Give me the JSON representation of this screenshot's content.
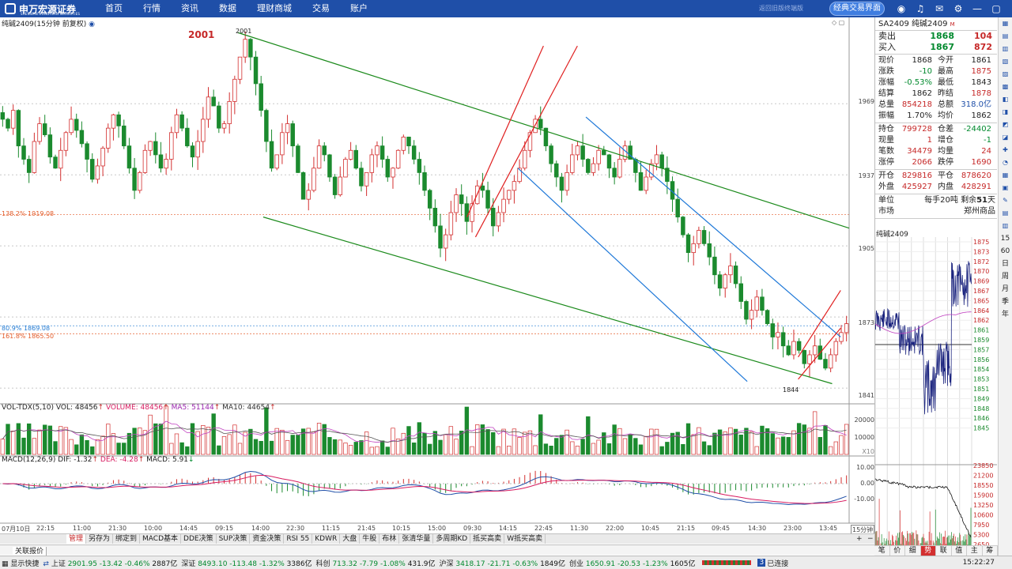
{
  "topbar": {
    "logo": "申万宏源证券",
    "logo_sub": "SHENWAN HONGYUAN SECURITIES",
    "nav": [
      "首页",
      "行情",
      "资讯",
      "数据",
      "理财商城",
      "交易",
      "账户"
    ],
    "hint": "返回旧版终端版",
    "classic_button": "经典交易界面"
  },
  "chart": {
    "title": "纯碱2409(15分钟 前复权)",
    "peak_label": "2001",
    "peak_note": "2001",
    "low_note": "1844",
    "fib": [
      {
        "text": "138.2% 1919.08",
        "color": "#e35d2b",
        "price": 1919.08
      },
      {
        "text": "80.9% 1869.08",
        "color": "#1f78d1",
        "price": 1869.08
      },
      {
        "text": "161.8% 1865.50",
        "color": "#e35d2b",
        "price": 1865.5
      }
    ],
    "price_axis": [
      "1969",
      "1937",
      "1905",
      "1873",
      "1841"
    ],
    "x_labels": [
      "07月10日",
      "22:15",
      "11:00",
      "21:30",
      "10:00",
      "14:45",
      "09:15",
      "14:00",
      "22:30",
      "11:15",
      "21:45",
      "10:15",
      "15:00",
      "09:30",
      "14:15",
      "22:45",
      "11:30",
      "22:00",
      "10:45",
      "21:15",
      "09:45",
      "14:30",
      "23:00",
      "13:45"
    ],
    "period": "15分钟",
    "vol_title": {
      "name": "VOL-TDX(5,10)",
      "vol": "VOL: 48456",
      "volume": "VOLUME: 48456",
      "ma5": "MA5: 51144",
      "ma10": "MA10: 44654"
    },
    "vol_axis": [
      "20000",
      "10000"
    ],
    "vol_unit": "X10",
    "macd_title": {
      "name": "MACD(12,26,9)",
      "dif": "DIF: -1.32",
      "dea": "DEA: -4.28",
      "macd": "MACD: 5.91"
    },
    "macd_axis": [
      "10.00",
      "0.00",
      "-10.00"
    ]
  },
  "chart_data": {
    "type": "candlestick",
    "symbol": "纯碱2409",
    "interval": "15分钟",
    "ylim": [
      1835,
      2005
    ],
    "closes": [
      1962,
      1958,
      1966,
      1950,
      1944,
      1938,
      1952,
      1960,
      1955,
      1945,
      1940,
      1948,
      1956,
      1962,
      1957,
      1951,
      1944,
      1935,
      1941,
      1949,
      1958,
      1964,
      1959,
      1950,
      1940,
      1930,
      1938,
      1948,
      1952,
      1946,
      1940,
      1944,
      1956,
      1964,
      1958,
      1950,
      1945,
      1952,
      1962,
      1972,
      1968,
      1958,
      1960,
      1970,
      1980,
      1990,
      1998,
      1990,
      1978,
      1966,
      1952,
      1940,
      1946,
      1956,
      1960,
      1950,
      1938,
      1926,
      1930,
      1940,
      1950,
      1946,
      1936,
      1928,
      1936,
      1944,
      1948,
      1940,
      1932,
      1938,
      1946,
      1950,
      1944,
      1936,
      1940,
      1948,
      1954,
      1950,
      1944,
      1938,
      1930,
      1922,
      1914,
      1904,
      1910,
      1920,
      1928,
      1924,
      1916,
      1924,
      1932,
      1930,
      1922,
      1914,
      1920,
      1926,
      1930,
      1934,
      1940,
      1948,
      1956,
      1962,
      1958,
      1950,
      1942,
      1936,
      1930,
      1938,
      1946,
      1950,
      1944,
      1938,
      1942,
      1948,
      1946,
      1940,
      1936,
      1944,
      1950,
      1944,
      1938,
      1930,
      1936,
      1942,
      1946,
      1940,
      1934,
      1926,
      1918,
      1910,
      1902,
      1906,
      1912,
      1906,
      1900,
      1892,
      1886,
      1892,
      1896,
      1888,
      1880,
      1872,
      1876,
      1882,
      1876,
      1870,
      1864,
      1866,
      1860,
      1856,
      1862,
      1858,
      1852,
      1856,
      1860,
      1854,
      1850,
      1856,
      1862,
      1866,
      1870
    ],
    "volume_axis": [
      0,
      25000
    ],
    "macd_axis": [
      -13,
      13
    ],
    "trendlines": [
      {
        "color": "green",
        "from": [
          0.28,
          2001
        ],
        "to": [
          1.0,
          1913
        ]
      },
      {
        "color": "green",
        "from": [
          0.31,
          1918
        ],
        "to": [
          0.98,
          1843
        ]
      },
      {
        "color": "red",
        "from": [
          0.55,
          1918
        ],
        "to": [
          0.64,
          1995
        ]
      },
      {
        "color": "red",
        "from": [
          0.56,
          1909
        ],
        "to": [
          0.68,
          1995
        ]
      },
      {
        "color": "blue",
        "from": [
          0.69,
          1963
        ],
        "to": [
          0.99,
          1864
        ]
      },
      {
        "color": "blue",
        "from": [
          0.61,
          1940
        ],
        "to": [
          0.88,
          1844
        ]
      },
      {
        "color": "red",
        "from": [
          0.94,
          1855
        ],
        "to": [
          0.99,
          1885
        ]
      },
      {
        "color": "red",
        "from": [
          0.94,
          1845
        ],
        "to": [
          0.99,
          1868
        ]
      }
    ]
  },
  "toolstrip": [
    "管理",
    "另存为",
    "绑定到",
    "MACD基本",
    "DDE决策",
    "SUP决策",
    "资金决策",
    "RSI 55",
    "KDWR",
    "大盘",
    "牛股",
    "布林",
    "张清华量",
    "多周期KD",
    "抵买高卖",
    "W抵买高卖"
  ],
  "bottom_tab": "关联报价",
  "statusbar": {
    "label": "显示快捷",
    "sh": {
      "name": "上证",
      "price": "2901.95",
      "chg": "-13.42",
      "pct": "-0.46%",
      "amt": "2887亿"
    },
    "sz": {
      "name": "深证",
      "price": "8493.10",
      "chg": "-113.48",
      "pct": "-1.32%",
      "amt": "3386亿"
    },
    "kc": {
      "name": "科创",
      "price": "713.32",
      "chg": "-7.79",
      "pct": "-1.08%",
      "amt": "431.9亿"
    },
    "hs": {
      "name": "沪深",
      "price": "3418.17",
      "chg": "-21.71",
      "pct": "-0.63%",
      "amt": "1849亿"
    },
    "cy": {
      "name": "创业",
      "price": "1650.91",
      "chg": "-20.53",
      "pct": "-1.23%",
      "amt": "1605亿"
    },
    "conn_num": "3",
    "conn": "已连接",
    "time": "15:22:27"
  },
  "quote": {
    "title": "SA2409 纯碱2409",
    "title_m": "M",
    "sell": {
      "label": "卖出",
      "price": "1868",
      "vol": "104"
    },
    "buy": {
      "label": "买入",
      "price": "1867",
      "vol": "872"
    },
    "rows1": [
      [
        "现价",
        "1868",
        "今开",
        "1861"
      ],
      [
        "涨跌",
        "-10",
        "最高",
        "1875"
      ],
      [
        "涨幅",
        "-0.53%",
        "最低",
        "1843"
      ],
      [
        "结算",
        "1862",
        "昨结",
        "1878"
      ],
      [
        "总量",
        "854218",
        "总额",
        "318.0亿"
      ],
      [
        "振幅",
        "1.70%",
        "均价",
        "1862"
      ]
    ],
    "rows2": [
      [
        "持仓",
        "799728",
        "仓差",
        "-24402"
      ],
      [
        "现量",
        "1",
        "增仓",
        "-1"
      ],
      [
        "笔数",
        "34479",
        "均量",
        "24"
      ],
      [
        "涨停",
        "2066",
        "跌停",
        "1690"
      ]
    ],
    "rows3": [
      [
        "开仓",
        "829816",
        "平仓",
        "878620"
      ],
      [
        "外盘",
        "425927",
        "内盘",
        "428291"
      ]
    ],
    "unit": {
      "label": "单位",
      "value": "每手20吨",
      "remain_label": "剩余",
      "remain": "51",
      "remain_unit": "天"
    },
    "market": {
      "label": "市场",
      "value": "郑州商品"
    },
    "mini_title": "纯碱2409",
    "mini_axis": [
      "1875",
      "1873",
      "1872",
      "1870",
      "1869",
      "1867",
      "1865",
      "1864",
      "1862",
      "1861",
      "1859",
      "1857",
      "1856",
      "1854",
      "1853",
      "1851",
      "1849",
      "1848",
      "1846",
      "1845"
    ],
    "mini_vol_axis": [
      "23850",
      "21200",
      "18550",
      "15900",
      "13250",
      "10600",
      "7950",
      "5300",
      "2650"
    ]
  },
  "rp_tabs": [
    "笔",
    "价",
    "细",
    "势",
    "联",
    "值",
    "主",
    "筹"
  ],
  "right_tools_text": [
    "15",
    "60",
    "日",
    "周",
    "月",
    "季",
    "年"
  ]
}
